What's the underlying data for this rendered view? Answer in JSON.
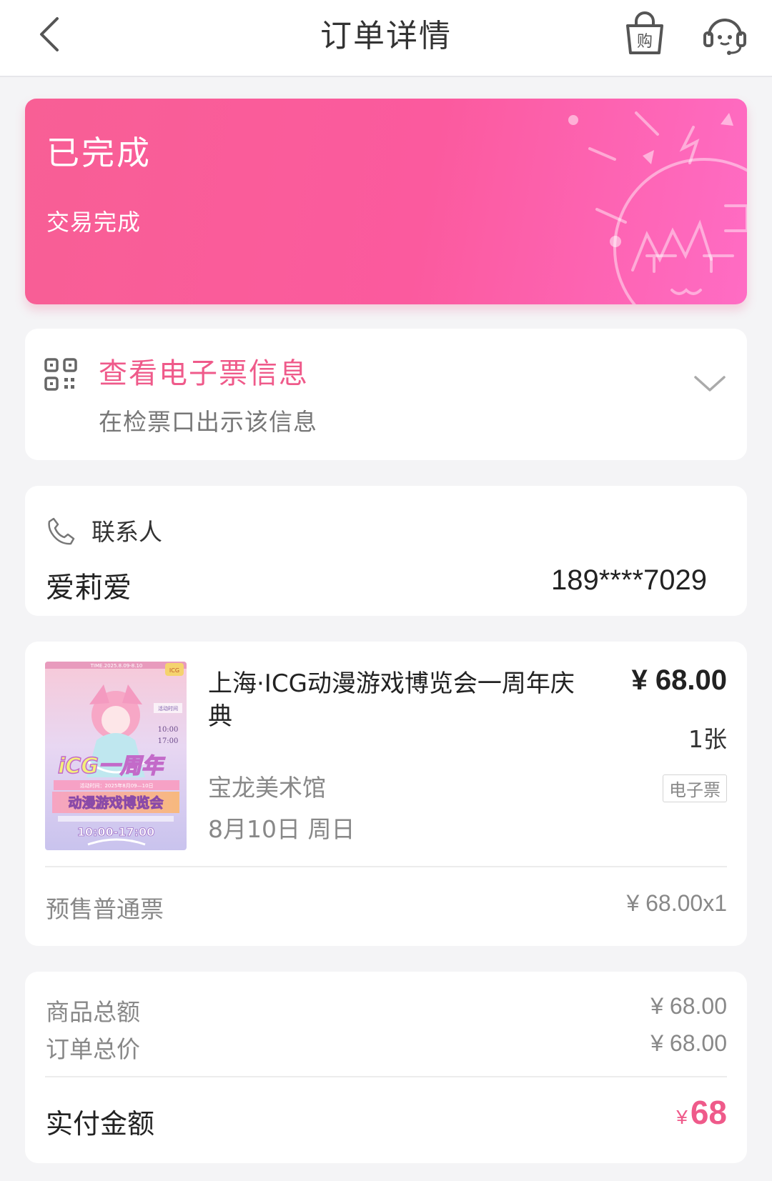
{
  "header": {
    "title": "订单详情"
  },
  "status": {
    "title": "已完成",
    "subtitle": "交易完成"
  },
  "eticket": {
    "title": "查看电子票信息",
    "subtitle": "在检票口出示该信息"
  },
  "contact": {
    "label": "联系人",
    "name": "爱莉爱",
    "phone": "189****7029"
  },
  "product": {
    "title": "上海·ICG动漫游戏博览会一周年庆典",
    "price": "¥ 68.00",
    "quantity": "1张",
    "venue": "宝龙美术馆",
    "date": "8月10日 周日",
    "ticket_badge": "电子票",
    "ticket_type": "预售普通票",
    "ticket_type_price": "¥ 68.00x1",
    "poster": {
      "top_text": "TIME.2025.8.09-8.10",
      "corner_badge": "ICG",
      "side_label": "活动时间",
      "time_open": "10:00",
      "time_close": "17:00",
      "big_text": "iCG一周年",
      "event_line": "活动时间：2025年8月09—10日",
      "main_title": "动漫游戏博览会",
      "hours": "10:00-17:00"
    }
  },
  "summary": {
    "goods_total_label": "商品总额",
    "goods_total_value": "¥ 68.00",
    "order_total_label": "订单总价",
    "order_total_value": "¥ 68.00",
    "paid_label": "实付金额",
    "paid_currency": "¥",
    "paid_amount": "68"
  },
  "colors": {
    "accent": "#ef5a8a",
    "banner_start": "#f85f95",
    "banner_end": "#ff6cc4"
  },
  "icons": [
    "chevron-left-icon",
    "shopping-bag-icon",
    "customer-service-icon",
    "qr-code-icon",
    "chevron-down-icon",
    "phone-icon"
  ]
}
